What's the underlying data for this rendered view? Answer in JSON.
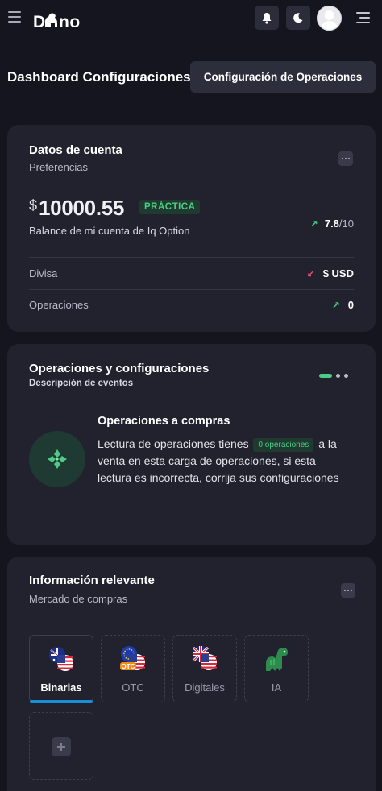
{
  "header": {
    "logo_text": "DINO",
    "menu_icon": "hamburger-icon",
    "notification_icon": "bell-icon",
    "theme_icon": "moon-icon",
    "avatar_icon": "user-avatar",
    "right_menu_icon": "align-right-icon"
  },
  "page": {
    "title": "Dashboard Configuraciones",
    "config_button": "Configuración de Operaciones"
  },
  "account_card": {
    "title": "Datos de cuenta",
    "subtitle": "Preferencias",
    "currency_symbol": "$",
    "balance": "10000.55",
    "mode_badge": "PRÁCTICA",
    "balance_label": "Balance de mi cuenta de Iq Option",
    "rating_value": "7.8",
    "rating_max": "/10",
    "rows": [
      {
        "label": "Divisa",
        "value": "$ USD",
        "trend": "down"
      },
      {
        "label": "Operaciones",
        "value": "0",
        "trend": "up"
      }
    ],
    "colors": {
      "up": "#4ecb84",
      "down": "#e2506a"
    }
  },
  "operations_card": {
    "title": "Operaciones y configuraciones",
    "subtitle": "Descripción de eventos",
    "item_title": "Operaciones a compras",
    "desc_before": "Lectura de operaciones tienes",
    "badge": "0 operaciones",
    "desc_after": "a la venta en esta carga de operaciones, si esta lectura es incorrecta, corrija sus configuraciones",
    "pager": {
      "count": 3,
      "active_index": 0
    }
  },
  "info_card": {
    "title": "Información relevante",
    "subtitle": "Mercado de compras",
    "tabs": [
      {
        "label": "Binarias",
        "icon": "australia-usa-flags-icon",
        "active": true
      },
      {
        "label": "OTC",
        "icon": "eu-usa-otc-flags-icon",
        "active": false
      },
      {
        "label": "Digitales",
        "icon": "uk-usa-flags-icon",
        "active": false
      },
      {
        "label": "IA",
        "icon": "dinosaur-icon",
        "active": false
      }
    ],
    "add_icon": "plus-icon"
  }
}
